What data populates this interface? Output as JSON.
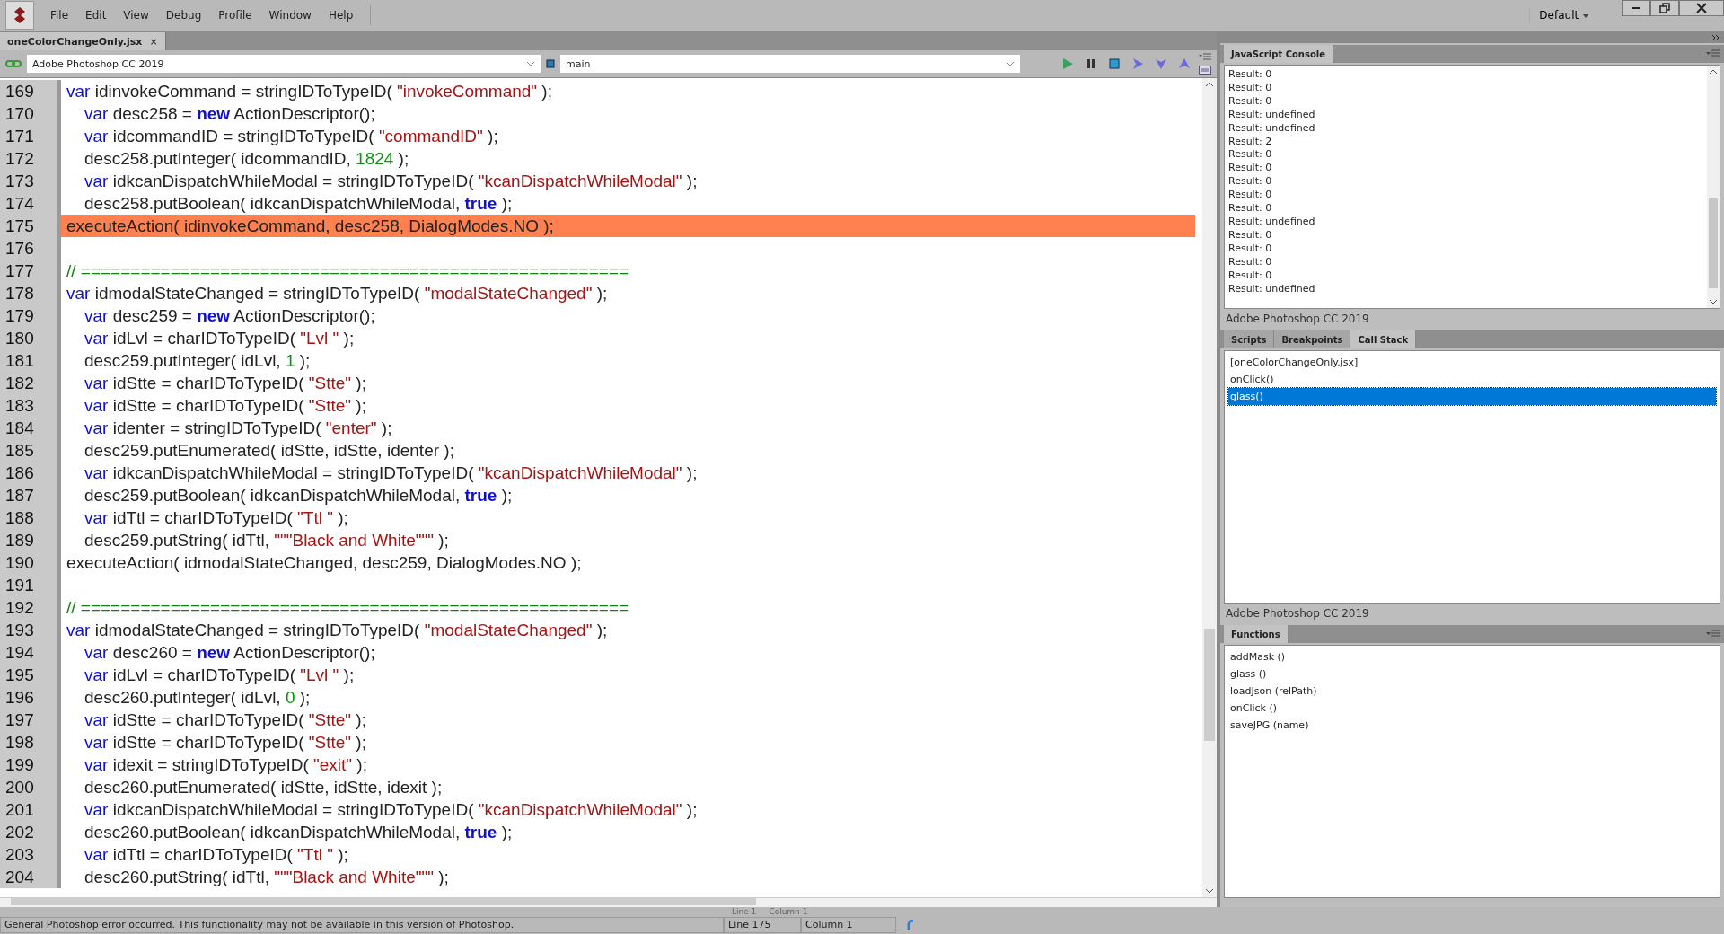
{
  "menu": [
    "File",
    "Edit",
    "View",
    "Debug",
    "Profile",
    "Window",
    "Help"
  ],
  "workspace": "Default",
  "document_tabs": [
    {
      "label": "oneColorChangeOnly.jsx",
      "close": "×",
      "selected": true
    }
  ],
  "toolbar": {
    "target": "Adobe Photoshop CC 2019",
    "engine": "main"
  },
  "code_lines": [
    {
      "number": "169",
      "indented": false,
      "highlighted": false,
      "tokens": [
        {
          "kind": "keyword",
          "text": "var"
        },
        {
          "kind": "plain",
          "text": " idinvokeCommand = stringIDToTypeID( "
        },
        {
          "kind": "string",
          "text": "\"invokeCommand\""
        },
        {
          "kind": "plain",
          "text": " );"
        }
      ]
    },
    {
      "number": "170",
      "indented": true,
      "highlighted": false,
      "tokens": [
        {
          "kind": "keyword",
          "text": "var"
        },
        {
          "kind": "plain",
          "text": " desc258 = "
        },
        {
          "kind": "keyword",
          "text": "new"
        },
        {
          "kind": "plain",
          "text": " ActionDescriptor();"
        }
      ]
    },
    {
      "number": "171",
      "indented": true,
      "highlighted": false,
      "tokens": [
        {
          "kind": "keyword",
          "text": "var"
        },
        {
          "kind": "plain",
          "text": " idcommandID = stringIDToTypeID( "
        },
        {
          "kind": "string",
          "text": "\"commandID\""
        },
        {
          "kind": "plain",
          "text": " );"
        }
      ]
    },
    {
      "number": "172",
      "indented": true,
      "highlighted": false,
      "tokens": [
        {
          "kind": "plain",
          "text": "desc258.putInteger( idcommandID, "
        },
        {
          "kind": "number",
          "text": "1824"
        },
        {
          "kind": "plain",
          "text": " );"
        }
      ]
    },
    {
      "number": "173",
      "indented": true,
      "highlighted": false,
      "tokens": [
        {
          "kind": "keyword",
          "text": "var"
        },
        {
          "kind": "plain",
          "text": " idkcanDispatchWhileModal = stringIDToTypeID( "
        },
        {
          "kind": "string",
          "text": "\"kcanDispatchWhileModal\""
        },
        {
          "kind": "plain",
          "text": " );"
        }
      ]
    },
    {
      "number": "174",
      "indented": true,
      "highlighted": false,
      "tokens": [
        {
          "kind": "plain",
          "text": "desc258.putBoolean( idkcanDispatchWhileModal, "
        },
        {
          "kind": "keyword",
          "text": "true"
        },
        {
          "kind": "plain",
          "text": " );"
        }
      ]
    },
    {
      "number": "175",
      "indented": false,
      "highlighted": true,
      "tokens": [
        {
          "kind": "plain",
          "text": "executeAction( idinvokeCommand, desc258, DialogModes.NO );"
        }
      ]
    },
    {
      "number": "176"
    },
    {
      "number": "177",
      "indented": false,
      "highlighted": false,
      "tokens": [
        {
          "kind": "comment",
          "text": "// ======================================================="
        }
      ]
    },
    {
      "number": "178",
      "indented": false,
      "highlighted": false,
      "tokens": [
        {
          "kind": "keyword",
          "text": "var"
        },
        {
          "kind": "plain",
          "text": " idmodalStateChanged = stringIDToTypeID( "
        },
        {
          "kind": "string",
          "text": "\"modalStateChanged\""
        },
        {
          "kind": "plain",
          "text": " );"
        }
      ]
    },
    {
      "number": "179",
      "indented": true,
      "highlighted": false,
      "tokens": [
        {
          "kind": "keyword",
          "text": "var"
        },
        {
          "kind": "plain",
          "text": " desc259 = "
        },
        {
          "kind": "keyword",
          "text": "new"
        },
        {
          "kind": "plain",
          "text": " ActionDescriptor();"
        }
      ]
    },
    {
      "number": "180",
      "indented": true,
      "highlighted": false,
      "tokens": [
        {
          "kind": "keyword",
          "text": "var"
        },
        {
          "kind": "plain",
          "text": " idLvl = charIDToTypeID( "
        },
        {
          "kind": "string",
          "text": "\"Lvl \""
        },
        {
          "kind": "plain",
          "text": " );"
        }
      ]
    },
    {
      "number": "181",
      "indented": true,
      "highlighted": false,
      "tokens": [
        {
          "kind": "plain",
          "text": "desc259.putInteger( idLvl, "
        },
        {
          "kind": "number",
          "text": "1"
        },
        {
          "kind": "plain",
          "text": " );"
        }
      ]
    },
    {
      "number": "182",
      "indented": true,
      "highlighted": false,
      "tokens": [
        {
          "kind": "keyword",
          "text": "var"
        },
        {
          "kind": "plain",
          "text": " idStte = charIDToTypeID( "
        },
        {
          "kind": "string",
          "text": "\"Stte\""
        },
        {
          "kind": "plain",
          "text": " );"
        }
      ]
    },
    {
      "number": "183",
      "indented": true,
      "highlighted": false,
      "tokens": [
        {
          "kind": "keyword",
          "text": "var"
        },
        {
          "kind": "plain",
          "text": " idStte = charIDToTypeID( "
        },
        {
          "kind": "string",
          "text": "\"Stte\""
        },
        {
          "kind": "plain",
          "text": " );"
        }
      ]
    },
    {
      "number": "184",
      "indented": true,
      "highlighted": false,
      "tokens": [
        {
          "kind": "keyword",
          "text": "var"
        },
        {
          "kind": "plain",
          "text": " identer = stringIDToTypeID( "
        },
        {
          "kind": "string",
          "text": "\"enter\""
        },
        {
          "kind": "plain",
          "text": " );"
        }
      ]
    },
    {
      "number": "185",
      "indented": true,
      "highlighted": false,
      "tokens": [
        {
          "kind": "plain",
          "text": "desc259.putEnumerated( idStte, idStte, identer );"
        }
      ]
    },
    {
      "number": "186",
      "indented": true,
      "highlighted": false,
      "tokens": [
        {
          "kind": "keyword",
          "text": "var"
        },
        {
          "kind": "plain",
          "text": " idkcanDispatchWhileModal = stringIDToTypeID( "
        },
        {
          "kind": "string",
          "text": "\"kcanDispatchWhileModal\""
        },
        {
          "kind": "plain",
          "text": " );"
        }
      ]
    },
    {
      "number": "187",
      "indented": true,
      "highlighted": false,
      "tokens": [
        {
          "kind": "plain",
          "text": "desc259.putBoolean( idkcanDispatchWhileModal, "
        },
        {
          "kind": "keyword",
          "text": "true"
        },
        {
          "kind": "plain",
          "text": " );"
        }
      ]
    },
    {
      "number": "188",
      "indented": true,
      "highlighted": false,
      "tokens": [
        {
          "kind": "keyword",
          "text": "var"
        },
        {
          "kind": "plain",
          "text": " idTtl = charIDToTypeID( "
        },
        {
          "kind": "string",
          "text": "\"Ttl \""
        },
        {
          "kind": "plain",
          "text": " );"
        }
      ]
    },
    {
      "number": "189",
      "indented": true,
      "highlighted": false,
      "tokens": [
        {
          "kind": "plain",
          "text": "desc259.putString( idTtl, "
        },
        {
          "kind": "string",
          "text": "\"\"\"Black and White\"\"\""
        },
        {
          "kind": "plain",
          "text": " );"
        }
      ]
    },
    {
      "number": "190",
      "indented": false,
      "highlighted": false,
      "tokens": [
        {
          "kind": "plain",
          "text": "executeAction( idmodalStateChanged, desc259, DialogModes.NO );"
        }
      ]
    },
    {
      "number": "191"
    },
    {
      "number": "192",
      "indented": false,
      "highlighted": false,
      "tokens": [
        {
          "kind": "comment",
          "text": "// ======================================================="
        }
      ]
    },
    {
      "number": "193",
      "indented": false,
      "highlighted": false,
      "tokens": [
        {
          "kind": "keyword",
          "text": "var"
        },
        {
          "kind": "plain",
          "text": " idmodalStateChanged = stringIDToTypeID( "
        },
        {
          "kind": "string",
          "text": "\"modalStateChanged\""
        },
        {
          "kind": "plain",
          "text": " );"
        }
      ]
    },
    {
      "number": "194",
      "indented": true,
      "highlighted": false,
      "tokens": [
        {
          "kind": "keyword",
          "text": "var"
        },
        {
          "kind": "plain",
          "text": " desc260 = "
        },
        {
          "kind": "keyword",
          "text": "new"
        },
        {
          "kind": "plain",
          "text": " ActionDescriptor();"
        }
      ]
    },
    {
      "number": "195",
      "indented": true,
      "highlighted": false,
      "tokens": [
        {
          "kind": "keyword",
          "text": "var"
        },
        {
          "kind": "plain",
          "text": " idLvl = charIDToTypeID( "
        },
        {
          "kind": "string",
          "text": "\"Lvl \""
        },
        {
          "kind": "plain",
          "text": " );"
        }
      ]
    },
    {
      "number": "196",
      "indented": true,
      "highlighted": false,
      "tokens": [
        {
          "kind": "plain",
          "text": "desc260.putInteger( idLvl, "
        },
        {
          "kind": "number",
          "text": "0"
        },
        {
          "kind": "plain",
          "text": " );"
        }
      ]
    },
    {
      "number": "197",
      "indented": true,
      "highlighted": false,
      "tokens": [
        {
          "kind": "keyword",
          "text": "var"
        },
        {
          "kind": "plain",
          "text": " idStte = charIDToTypeID( "
        },
        {
          "kind": "string",
          "text": "\"Stte\""
        },
        {
          "kind": "plain",
          "text": " );"
        }
      ]
    },
    {
      "number": "198",
      "indented": true,
      "highlighted": false,
      "tokens": [
        {
          "kind": "keyword",
          "text": "var"
        },
        {
          "kind": "plain",
          "text": " idStte = charIDToTypeID( "
        },
        {
          "kind": "string",
          "text": "\"Stte\""
        },
        {
          "kind": "plain",
          "text": " );"
        }
      ]
    },
    {
      "number": "199",
      "indented": true,
      "highlighted": false,
      "tokens": [
        {
          "kind": "keyword",
          "text": "var"
        },
        {
          "kind": "plain",
          "text": " idexit = stringIDToTypeID( "
        },
        {
          "kind": "string",
          "text": "\"exit\""
        },
        {
          "kind": "plain",
          "text": " );"
        }
      ]
    },
    {
      "number": "200",
      "indented": true,
      "highlighted": false,
      "tokens": [
        {
          "kind": "plain",
          "text": "desc260.putEnumerated( idStte, idStte, idexit );"
        }
      ]
    },
    {
      "number": "201",
      "indented": true,
      "highlighted": false,
      "tokens": [
        {
          "kind": "keyword",
          "text": "var"
        },
        {
          "kind": "plain",
          "text": " idkcanDispatchWhileModal = stringIDToTypeID( "
        },
        {
          "kind": "string",
          "text": "\"kcanDispatchWhileModal\""
        },
        {
          "kind": "plain",
          "text": " );"
        }
      ]
    },
    {
      "number": "202",
      "indented": true,
      "highlighted": false,
      "tokens": [
        {
          "kind": "plain",
          "text": "desc260.putBoolean( idkcanDispatchWhileModal, "
        },
        {
          "kind": "keyword",
          "text": "true"
        },
        {
          "kind": "plain",
          "text": " );"
        }
      ]
    },
    {
      "number": "203",
      "indented": true,
      "highlighted": false,
      "tokens": [
        {
          "kind": "keyword",
          "text": "var"
        },
        {
          "kind": "plain",
          "text": " idTtl = charIDToTypeID( "
        },
        {
          "kind": "string",
          "text": "\"Ttl \""
        },
        {
          "kind": "plain",
          "text": " );"
        }
      ]
    },
    {
      "number": "204",
      "indented": true,
      "highlighted": false,
      "tokens": [
        {
          "kind": "plain",
          "text": "desc260.putString( idTtl, "
        },
        {
          "kind": "string",
          "text": "\"\"\"Black and White\"\"\""
        },
        {
          "kind": "plain",
          "text": " );"
        }
      ]
    }
  ],
  "console": {
    "tab": "JavaScript Console",
    "lines": [
      "Result: 0",
      "Result: 0",
      "Result: 0",
      "Result: undefined",
      "Result: undefined",
      "Result: 2",
      "Result: 0",
      "Result: 0",
      "Result: 0",
      "Result: 0",
      "Result: 0",
      "Result: undefined",
      "Result: 0",
      "Result: 0",
      "Result: 0",
      "Result: 0",
      "Result: undefined"
    ],
    "footer": "Adobe Photoshop CC 2019"
  },
  "debug_panel": {
    "tabs": [
      {
        "label": "Scripts",
        "selected": false
      },
      {
        "label": "Breakpoints",
        "selected": false
      },
      {
        "label": "Call Stack",
        "selected": true
      }
    ],
    "items": [
      {
        "label": "[oneColorChangeOnly.jsx]",
        "selected": false
      },
      {
        "label": "onClick()",
        "selected": false
      },
      {
        "label": "glass()",
        "selected": true
      }
    ],
    "footer": "Adobe Photoshop CC 2019"
  },
  "functions": {
    "tab": "Functions",
    "items": [
      "addMask ()",
      "glass ()",
      "loadJson (relPath)",
      "onClick ()",
      "saveJPG (name)"
    ]
  },
  "status_bar": {
    "message": "General Photoshop error occurred. This functionality may not be available in this version of Photoshop.",
    "line": "Line 175",
    "column": "Column 1",
    "hidden_line": "Line 1",
    "hidden_column": "Column 1"
  }
}
